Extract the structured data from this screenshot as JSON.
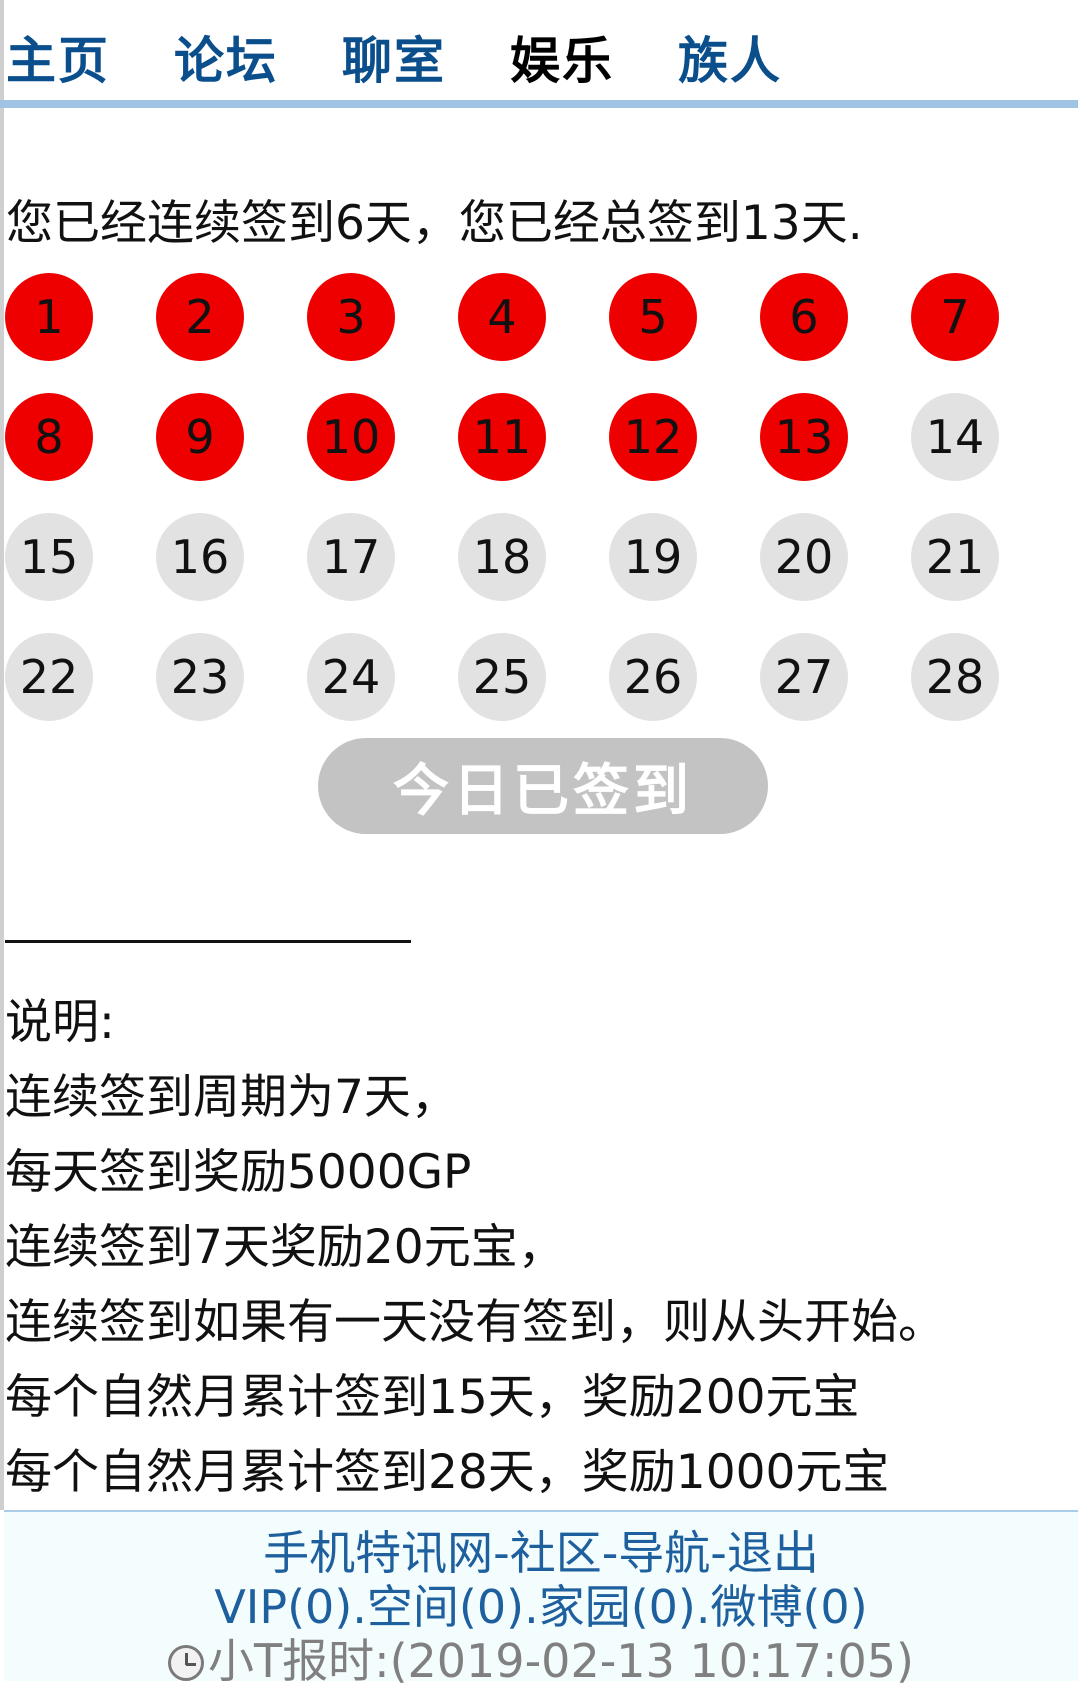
{
  "nav": {
    "items": [
      {
        "label": "主页",
        "current": false
      },
      {
        "label": "论坛",
        "current": false
      },
      {
        "label": "聊室",
        "current": false
      },
      {
        "label": "娱乐",
        "current": true
      },
      {
        "label": "族人",
        "current": false
      }
    ]
  },
  "summary": "您已经连续签到6天，您已经总签到13天.",
  "calendar": {
    "days": [
      "1",
      "2",
      "3",
      "4",
      "5",
      "6",
      "7",
      "8",
      "9",
      "10",
      "11",
      "12",
      "13",
      "14",
      "15",
      "16",
      "17",
      "18",
      "19",
      "20",
      "21",
      "22",
      "23",
      "24",
      "25",
      "26",
      "27",
      "28"
    ],
    "signed_count": 13,
    "colors": {
      "signed": "#ee0000",
      "unsigned": "#e2e2e2"
    }
  },
  "sign_button": {
    "label": "今日已签到"
  },
  "notes": {
    "title": "说明:",
    "lines": [
      "连续签到周期为7天，",
      "每天签到奖励5000GP",
      "连续签到7天奖励20元宝，",
      "连续签到如果有一天没有签到，则从头开始。",
      "每个自然月累计签到15天，奖励200元宝",
      "每个自然月累计签到28天，奖励1000元宝"
    ]
  },
  "footer": {
    "links1": [
      "手机特讯网",
      "社区",
      "导航",
      "退出"
    ],
    "sep1": "-",
    "links2": [
      "VIP(0)",
      "空间(0)",
      "家园(0)",
      "微博(0)"
    ],
    "sep2": ".",
    "time_label": "小T报时:(2019-02-13 10:17:05)"
  }
}
